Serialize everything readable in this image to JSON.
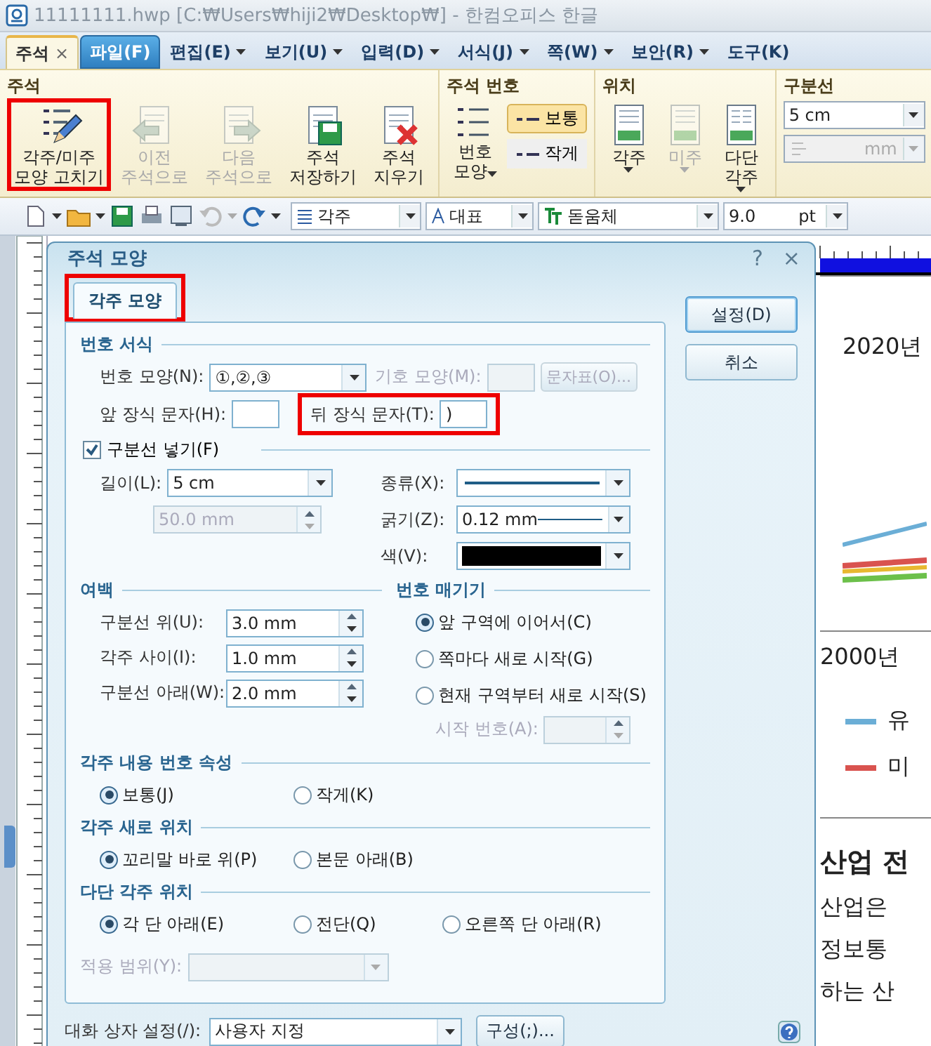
{
  "window": {
    "title": "11111111.hwp [C:₩Users₩hiji2₩Desktop₩] - 한컴오피스 한글"
  },
  "menu_tabs": [
    {
      "label": "주석",
      "kind": "context",
      "selected": true,
      "close": "×"
    },
    {
      "label": "파일(F)",
      "kind": "file",
      "selected": false
    },
    {
      "label": "편집(E)",
      "kind": "menu",
      "selected": false
    },
    {
      "label": "보기(U)",
      "kind": "menu",
      "selected": false
    },
    {
      "label": "입력(D)",
      "kind": "menu",
      "selected": false
    },
    {
      "label": "서식(J)",
      "kind": "menu",
      "selected": false
    },
    {
      "label": "쪽(W)",
      "kind": "menu",
      "selected": false
    },
    {
      "label": "보안(R)",
      "kind": "menu",
      "selected": false
    },
    {
      "label": "도구(K)",
      "kind": "menu",
      "selected": false
    }
  ],
  "ribbon": {
    "groups": [
      {
        "title": "주석",
        "kind": "buttons",
        "buttons": [
          {
            "kind": "edit",
            "lines": [
              "각주/미주",
              "모양 고치기"
            ],
            "disabled": false,
            "dropdown": false,
            "highlighted": true
          },
          {
            "kind": "prev",
            "lines": [
              "이전",
              "주석으로"
            ],
            "disabled": true,
            "dropdown": false,
            "highlighted": false
          },
          {
            "kind": "next",
            "lines": [
              "다음",
              "주석으로"
            ],
            "disabled": true,
            "dropdown": false,
            "highlighted": false
          },
          {
            "kind": "save",
            "lines": [
              "주석",
              "저장하기"
            ],
            "disabled": false,
            "dropdown": false,
            "highlighted": false
          },
          {
            "kind": "delete",
            "lines": [
              "주석",
              "지우기"
            ],
            "disabled": false,
            "dropdown": false,
            "highlighted": false
          }
        ]
      },
      {
        "title": "주석 번호",
        "kind": "numbering",
        "button": {
          "lines": [
            "번호",
            "모양"
          ],
          "dropdown": true
        },
        "options": [
          {
            "label": "보통",
            "selected": true
          },
          {
            "label": "작게",
            "selected": false
          }
        ]
      },
      {
        "title": "위치",
        "kind": "buttons",
        "buttons": [
          {
            "kind": "page",
            "lines": [
              "각주"
            ],
            "disabled": false,
            "dropdown": true,
            "highlighted": false
          },
          {
            "kind": "page",
            "lines": [
              "미주"
            ],
            "disabled": true,
            "dropdown": true,
            "highlighted": false
          },
          {
            "kind": "columns",
            "lines": [
              "다단",
              "각주"
            ],
            "disabled": false,
            "dropdown": true,
            "highlighted": false
          }
        ]
      },
      {
        "title": "구분선",
        "kind": "separator",
        "length": "5 cm",
        "unit": "mm"
      }
    ]
  },
  "toolbar": {
    "style": "각주",
    "language": "대표",
    "font": "돋움체",
    "size": "9.0",
    "size_unit": "pt"
  },
  "dialog": {
    "title": "주석 모양",
    "help": "?",
    "close": "×",
    "tabs": [
      {
        "label": "각주 모양",
        "selected": true,
        "highlighted": true
      }
    ],
    "buttons": [
      {
        "label": "설정(D)",
        "default": true
      },
      {
        "label": "취소",
        "default": false
      }
    ],
    "number_format": {
      "title": "번호 서식",
      "number_shape": {
        "label": "번호 모양(N):",
        "value": "①,②,③"
      },
      "symbol_shape": {
        "label": "기호 모양(M):",
        "disabled": true
      },
      "char_map": {
        "label": "문자표(O)...",
        "disabled": true
      },
      "prefix": {
        "label": "앞 장식 문자(H):",
        "highlighted": false
      },
      "suffix": {
        "label": "뒤 장식 문자(T):",
        "value": ")",
        "highlighted": true
      }
    },
    "separator": {
      "label": "구분선 넣기(F)",
      "checked": true,
      "length": {
        "label": "길이(L):",
        "value": "5 cm"
      },
      "length_mm": {
        "value": "50.0 mm",
        "disabled": true
      },
      "line_type": {
        "label": "종류(X):"
      },
      "thickness": {
        "label": "굵기(Z):",
        "value": "0.12 mm"
      },
      "color": {
        "label": "색(V):",
        "color": "#000000"
      }
    },
    "margins": {
      "title": "여백",
      "fields": [
        {
          "label": "구분선 위(U):",
          "value": "3.0 mm"
        },
        {
          "label": "각주 사이(I):",
          "value": "1.0 mm"
        },
        {
          "label": "구분선 아래(W):",
          "value": "2.0 mm"
        }
      ]
    },
    "numbering": {
      "title": "번호 매기기",
      "options": [
        {
          "label": "앞 구역에 이어서(C)",
          "selected": true
        },
        {
          "label": "쪽마다 새로 시작(G)",
          "selected": false
        },
        {
          "label": "현재 구역부터 새로 시작(S)",
          "selected": false
        }
      ],
      "start": {
        "label": "시작 번호(A):",
        "disabled": true
      }
    },
    "radio_groups": [
      {
        "title": "각주 내용 번호 속성",
        "options": [
          {
            "label": "보통(J)",
            "selected": true
          },
          {
            "label": "작게(K)",
            "selected": false
          }
        ]
      },
      {
        "title": "각주 새로 위치",
        "options": [
          {
            "label": "꼬리말 바로 위(P)",
            "selected": true
          },
          {
            "label": "본문 아래(B)",
            "selected": false
          }
        ]
      },
      {
        "title": "다단 각주 위치",
        "options": [
          {
            "label": "각 단 아래(E)",
            "selected": true
          },
          {
            "label": "전단(Q)",
            "selected": false
          },
          {
            "label": "오른쪽 단 아래(R)",
            "selected": false
          }
        ]
      }
    ],
    "apply_range": {
      "label": "적용 범위(Y):",
      "disabled": true
    },
    "dialog_setting": {
      "label": "대화 상자 설정(/):",
      "value": "사용자 지정"
    },
    "configure_button": "구성(;)..."
  },
  "document": {
    "chart_title": "2020년",
    "axis_label": "2000년",
    "legend": [
      {
        "label": "유",
        "color": "#6baed6"
      },
      {
        "label": "미",
        "color": "#d9534f"
      }
    ],
    "heading": "산업 전",
    "lines": [
      "산업은",
      "정보통",
      "하는 산"
    ]
  }
}
